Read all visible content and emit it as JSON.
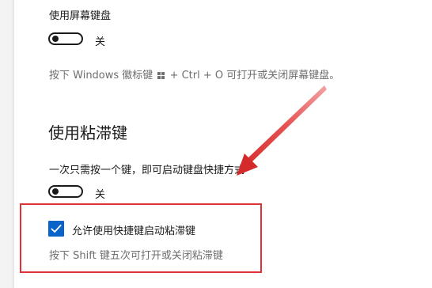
{
  "onscreen_keyboard": {
    "title": "使用屏幕键盘",
    "toggle_label": "关",
    "hint_prefix": "按下 Windows 徽标键",
    "hint_suffix": "+ Ctrl + O 可打开或关闭屏幕键盘。"
  },
  "sticky_keys": {
    "heading": "使用粘滞键",
    "description": "一次只需按一个键，即可启动键盘快捷方式",
    "toggle_label": "关",
    "checkbox_label": "允许使用快捷键启动粘滞键",
    "checkbox_hint": "按下 Shift 键五次可打开或关闭粘滞键",
    "checkbox_checked": true
  },
  "colors": {
    "accent": "#0a63c9",
    "annotation": "#e03232",
    "hint_text": "#6e6e6e"
  }
}
